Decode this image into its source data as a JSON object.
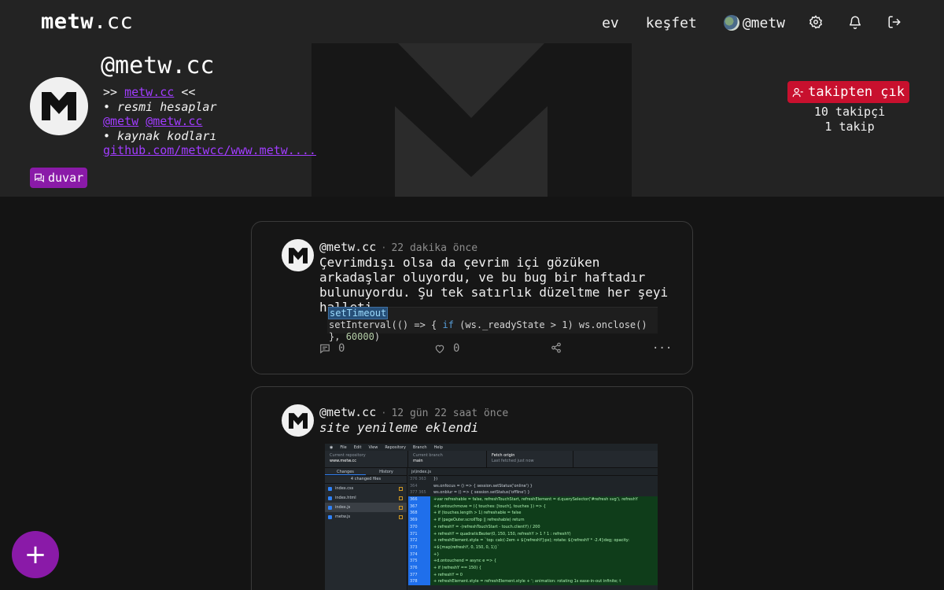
{
  "header": {
    "logo_bold": "metw",
    "logo_rest": ".cc",
    "nav": {
      "home": "ev",
      "explore": "keşfet",
      "user": "@metw"
    },
    "icons": [
      "gear-icon",
      "bell-icon",
      "logout-icon"
    ]
  },
  "profile": {
    "name": "@metw.cc",
    "bio": {
      "line1_prefix": ">>",
      "line1_link": "metw.cc",
      "line1_suffix": "<<",
      "line2": "• resmi hesaplar",
      "line3_link1": "@metw",
      "line3_link2": "@metw.cc",
      "line4": "• kaynak kodları",
      "line5_link": "github.com/metwcc/www.metw...."
    },
    "wall_button": "duvar",
    "unfollow_button": "takipten çık",
    "followers": "10 takipçi",
    "following": "1 takip"
  },
  "posts": [
    {
      "author": "@metw.cc",
      "time": "22 dakika önce",
      "text": "Çevrimdışı olsa da çevrim içi gözüken arkadaşlar oluyordu, ve bu bug bir haftadır bulunuyordu. Şu tek satırlık düzeltme her şeyi halleti...",
      "code": {
        "selected": "setTimeout",
        "line2_a": "setInterval(() => { ",
        "line2_kw": "if",
        "line2_b": " (ws._readyState > 1) ws.onclose() }, ",
        "line2_num": "60000",
        "line2_c": ")"
      },
      "comments": "0",
      "likes": "0"
    },
    {
      "author": "@metw.cc",
      "time": "12 gün 22 saat önce",
      "text": "site yenileme eklendi",
      "screenshot": {
        "menu": [
          "File",
          "Edit",
          "View",
          "Repository",
          "Branch",
          "Help"
        ],
        "repo_label": "Current repository",
        "repo_value": "www.metw.cc",
        "branch_label": "Current branch",
        "branch_value": "main",
        "fetch_label": "Fetch origin",
        "fetch_sub": "Last fetched just now",
        "tab_changes": "Changes",
        "tab_history": "History",
        "changed_files": "4 changed files",
        "files": [
          "index.css",
          "index.html",
          "index.js",
          "metw.js"
        ],
        "path": "js\\index.js",
        "lines": [
          {
            "n": "376 363",
            "src": "})",
            "add": false
          },
          {
            "n": "364",
            "src": "ws.onfocus = () => { session.setStatus('online') }",
            "add": false
          },
          {
            "n": "377 365",
            "src": "ws.onblur = () => { session.setStatus('offline') }",
            "add": false
          },
          {
            "n": "366",
            "src": "+var refreshable = false, refreshTouchStart, refreshElement = d.querySelector('#refresh svg'), refreshY",
            "add": true
          },
          {
            "n": "367",
            "src": "+d.ontouchmove = ({ touches: [touch], touches }) => {",
            "add": true
          },
          {
            "n": "368",
            "src": "+    if (touches.length > 1) refreshable = false",
            "add": true
          },
          {
            "n": "369",
            "src": "+    if (pageOuter.scrollTop || refreshable) return",
            "add": true
          },
          {
            "n": "370",
            "src": "+    refreshY = -(refreshTouchStart - touch.clientY) / 200",
            "add": true
          },
          {
            "n": "371",
            "src": "+    refreshY = quadraticBezier(0, 150, 150, refreshY > 1 ? 1 : refreshY)",
            "add": true
          },
          {
            "n": "372",
            "src": "+    refreshElement.style = `top: calc(-2em + ${refreshY}px); rotate: ${refreshY * -2.4}deg; opacity:",
            "add": true
          },
          {
            "n": "373",
            "src": "+${map(refreshY, 0, 150, 0, 1)}`",
            "add": true
          },
          {
            "n": "374",
            "src": "+}",
            "add": true
          },
          {
            "n": "375",
            "src": "+d.ontouchend = async e => {",
            "add": true
          },
          {
            "n": "376",
            "src": "+    if (refreshY == 150) {",
            "add": true
          },
          {
            "n": "377",
            "src": "+        refreshY = 0",
            "add": true
          },
          {
            "n": "378",
            "src": "+        refreshElement.style = refreshElement.style + '; animation: rotating 1s ease-in-out infinite; t",
            "add": true
          }
        ]
      }
    }
  ],
  "fab_label": "+",
  "colors": {
    "accent_purple": "#8a1aa8",
    "link_purple": "#a13cff",
    "danger_red": "#c8102e",
    "background": "#141414",
    "header_bg": "#232323"
  }
}
